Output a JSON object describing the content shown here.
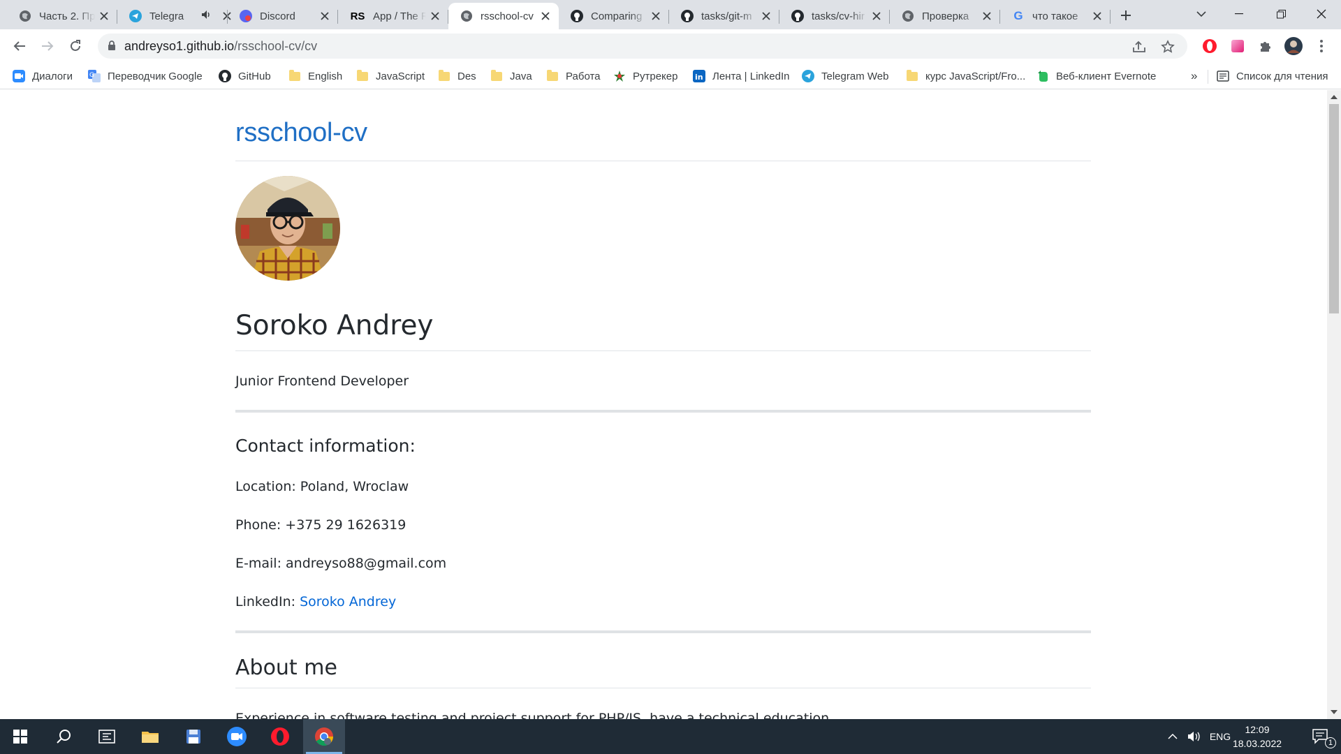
{
  "browser": {
    "tabs": [
      {
        "title": "Часть 2. Пр",
        "icon": "globe-icon"
      },
      {
        "title": "Telegra",
        "icon": "telegram-icon",
        "audio": true
      },
      {
        "title": "Discord",
        "icon": "discord-icon"
      },
      {
        "title": "App / The R",
        "icon": "rs-icon"
      },
      {
        "title": "rsschool-cv",
        "icon": "globe-icon",
        "active": true
      },
      {
        "title": "Comparing",
        "icon": "github-icon"
      },
      {
        "title": "tasks/git-m",
        "icon": "github-icon"
      },
      {
        "title": "tasks/cv-hir",
        "icon": "github-icon"
      },
      {
        "title": "Проверка",
        "icon": "globe-icon"
      },
      {
        "title": "что такое",
        "icon": "google-icon"
      }
    ],
    "url": {
      "domain": "andreyso1.github.io",
      "path": "/rsschool-cv/cv"
    },
    "bookmarks": [
      {
        "label": "Диалоги",
        "icon": "zoom-icon"
      },
      {
        "label": "Переводчик Google",
        "icon": "translate-icon"
      },
      {
        "label": "GitHub",
        "icon": "github-icon"
      },
      {
        "label": "English",
        "icon": "folder-icon"
      },
      {
        "label": "JavaScript",
        "icon": "folder-icon"
      },
      {
        "label": "Des",
        "icon": "folder-icon"
      },
      {
        "label": "Java",
        "icon": "folder-icon"
      },
      {
        "label": "Работа",
        "icon": "folder-icon"
      },
      {
        "label": "Рутрекер",
        "icon": "rutracker-icon"
      },
      {
        "label": "Лента | LinkedIn",
        "icon": "linkedin-icon"
      },
      {
        "label": "Telegram Web",
        "icon": "telegram-icon"
      },
      {
        "label": "курс JavaScript/Fro...",
        "icon": "folder-icon"
      },
      {
        "label": "Веб-клиент Evernote",
        "icon": "evernote-icon"
      }
    ],
    "bookmarks_more": "»",
    "reading_list": "Список для чтения"
  },
  "page": {
    "site_title": "rsschool-cv",
    "name": "Soroko Andrey",
    "position": "Junior Frontend Developer",
    "contact_heading": "Contact information:",
    "location": "Location: Poland, Wroclaw",
    "phone": "Phone: +375 29 1626319",
    "email": "E-mail: andreyso88@gmail.com",
    "linkedin_label": "LinkedIn:",
    "linkedin_link": "Soroko Andrey",
    "about_heading": "About me",
    "about_text": "Experience in software testing and project support for PHP/JS, have a technical education."
  },
  "taskbar": {
    "apps": [
      "windows-start-icon",
      "search-icon",
      "task-view-icon",
      "file-explorer-icon",
      "save-app-icon",
      "zoom-icon",
      "opera-icon",
      "chrome-icon"
    ],
    "lang": "ENG",
    "time": "12:09",
    "date": "18.03.2022",
    "notifications": "1"
  }
}
